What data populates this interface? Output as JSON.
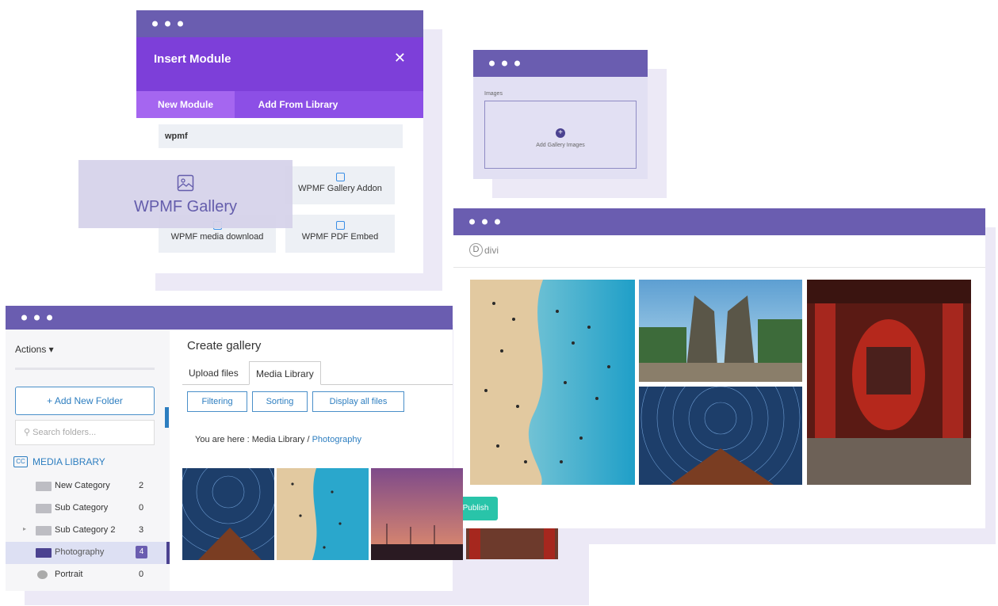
{
  "insert_module": {
    "title": "Insert Module",
    "close_glyph": "✕",
    "tabs": [
      {
        "label": "New Module",
        "active": true
      },
      {
        "label": "Add From Library",
        "active": false
      }
    ],
    "search_value": "wpmf",
    "highlight_label": "WPMF Gallery",
    "cards": [
      {
        "label": "WPMF Gallery Addon",
        "icon": "gallery-addon-icon"
      },
      {
        "label": "WPMF media download",
        "icon": "download-icon"
      },
      {
        "label": "WPMF PDF Embed",
        "icon": "pdf-icon"
      }
    ]
  },
  "images_panel": {
    "label": "Images",
    "add_label": "Add Gallery Images",
    "plus_glyph": "+"
  },
  "divi": {
    "logo_letter": "D",
    "logo_text": "divi",
    "publish_label": "Publish"
  },
  "media": {
    "actions_label": "Actions ▾",
    "add_folder_label": "+ Add New Folder",
    "search_placeholder": "Search folders...",
    "root_label": "MEDIA LIBRARY",
    "folders": [
      {
        "name": "New Category",
        "count": "2"
      },
      {
        "name": "Sub Category",
        "count": "0"
      },
      {
        "name": "Sub Category 2",
        "count": "3"
      },
      {
        "name": "Photography",
        "count": "4"
      },
      {
        "name": "Portrait",
        "count": "0"
      }
    ],
    "content_title": "Create gallery",
    "tabs": [
      {
        "label": "Upload files",
        "active": false
      },
      {
        "label": "Media Library",
        "active": true
      }
    ],
    "buttons": [
      "Filtering",
      "Sorting",
      "Display all files"
    ],
    "breadcrumb_prefix": "You are here : Media Library / ",
    "breadcrumb_link": "Photography"
  },
  "colors": {
    "titlebar": "#6a5db0",
    "insert_header": "#7d3fd9",
    "accent_blue": "#2d7ec0",
    "publish_green": "#29c4a9"
  }
}
